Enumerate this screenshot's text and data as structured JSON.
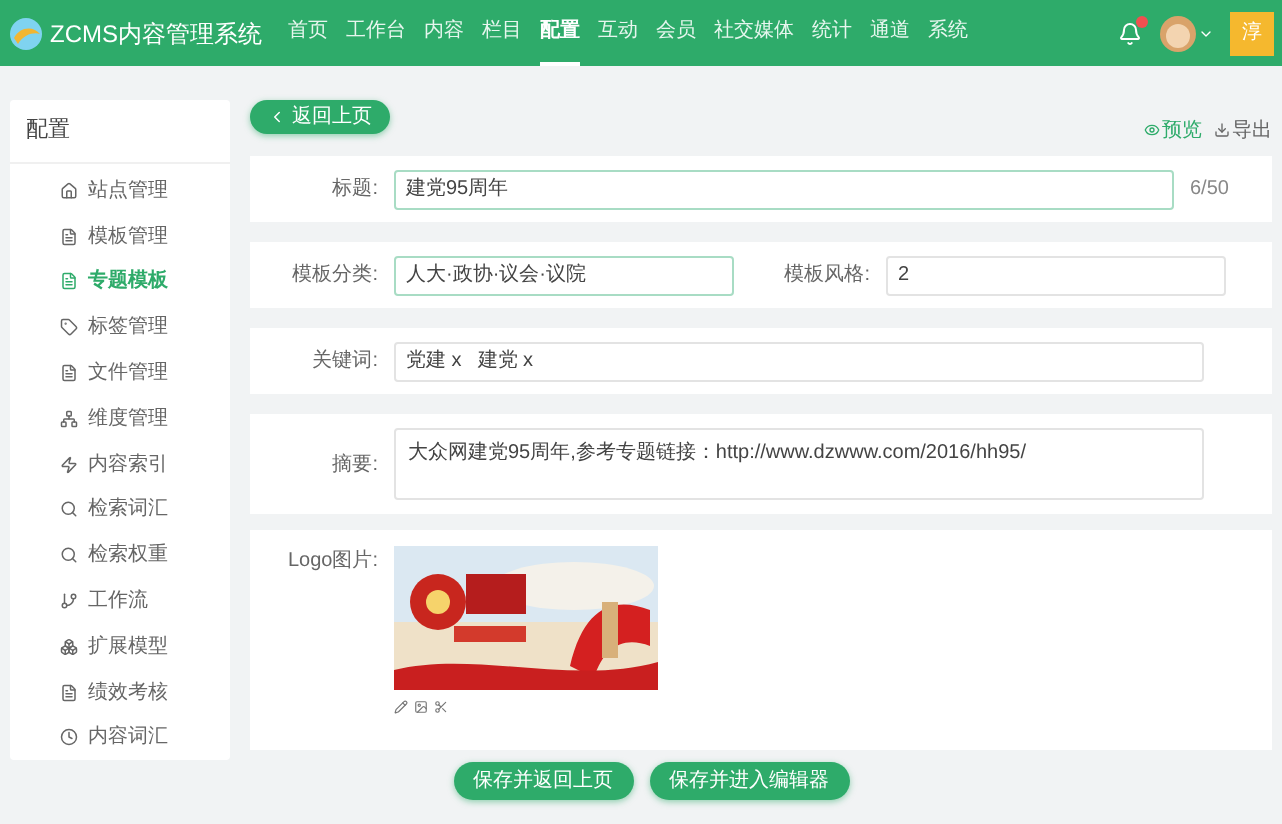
{
  "header": {
    "logo_text": "ZCMS内容管理系统",
    "nav": [
      {
        "label": "首页",
        "selected": false
      },
      {
        "label": "工作台",
        "selected": false
      },
      {
        "label": "内容",
        "selected": false
      },
      {
        "label": "栏目",
        "selected": false
      },
      {
        "label": "配置",
        "selected": true
      },
      {
        "label": "互动",
        "selected": false
      },
      {
        "label": "会员",
        "selected": false
      },
      {
        "label": "社交媒体",
        "selected": false
      },
      {
        "label": "统计",
        "selected": false
      },
      {
        "label": "通道",
        "selected": false
      },
      {
        "label": "系统",
        "selected": false
      }
    ],
    "notification_badge": true,
    "user_initial": "淳"
  },
  "sidebar": {
    "title": "配置",
    "items": [
      {
        "label": "站点管理",
        "kind": "home",
        "selected": false
      },
      {
        "label": "模板管理",
        "kind": "file",
        "selected": false
      },
      {
        "label": "专题模板",
        "kind": "file",
        "selected": true
      },
      {
        "label": "标签管理",
        "kind": "tag",
        "selected": false
      },
      {
        "label": "文件管理",
        "kind": "file",
        "selected": false
      },
      {
        "label": "维度管理",
        "kind": "sitemap",
        "selected": false
      },
      {
        "label": "内容索引",
        "kind": "bolt",
        "selected": false
      },
      {
        "label": "检索词汇",
        "kind": "search",
        "selected": false
      },
      {
        "label": "检索权重",
        "kind": "search",
        "selected": false
      },
      {
        "label": "工作流",
        "kind": "flow",
        "selected": false
      },
      {
        "label": "扩展模型",
        "kind": "cubes",
        "selected": false
      },
      {
        "label": "绩效考核",
        "kind": "file",
        "selected": false
      },
      {
        "label": "内容词汇",
        "kind": "clock",
        "selected": false
      }
    ]
  },
  "toolbar": {
    "back_button": "返回上页",
    "preview": "预览",
    "export": "导出"
  },
  "form": {
    "title": {
      "label": "标题:",
      "value": "建党95周年",
      "counter": "6/50"
    },
    "category": {
      "label": "模板分类:",
      "value": "人大·政协·议会·议院"
    },
    "style": {
      "label": "模板风格:",
      "value": "2"
    },
    "keywords": {
      "label": "关键词:",
      "tags": [
        "党建 x",
        "建党 x"
      ]
    },
    "summary": {
      "label": "摘要:",
      "value": "大众网建党95周年,参考专题链接：http://www.dzwww.com/2016/hh95/"
    },
    "logo": {
      "label": "Logo图片:"
    }
  },
  "actions": [
    "保存并返回上页",
    "保存并进入编辑器"
  ]
}
